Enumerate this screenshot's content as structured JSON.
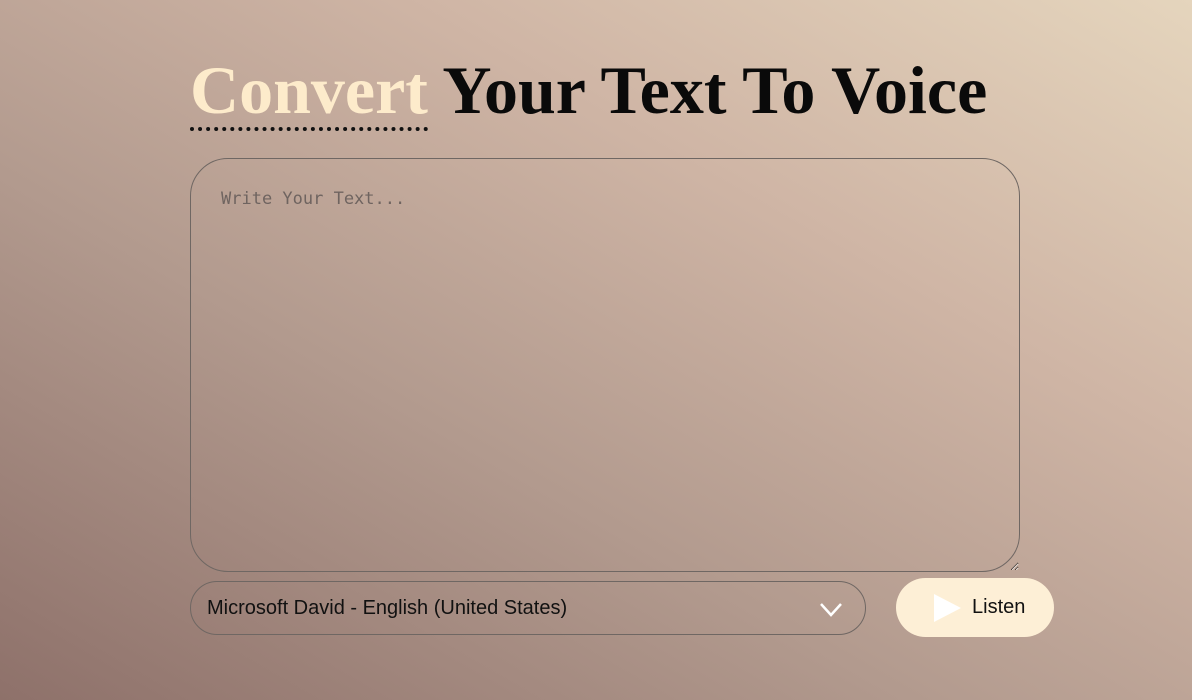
{
  "header": {
    "title_accent": "Convert",
    "title_rest": "Your Text To Voice"
  },
  "editor": {
    "placeholder": "Write Your Text...",
    "value": ""
  },
  "voice_select": {
    "selected": "Microsoft David - English (United States)",
    "icon": "chevron-down-icon"
  },
  "listen_button": {
    "label": "Listen",
    "icon": "play-icon"
  },
  "colors": {
    "accent": "#fdebcb",
    "button_bg": "#fdefd6",
    "border": "#6f6763"
  }
}
